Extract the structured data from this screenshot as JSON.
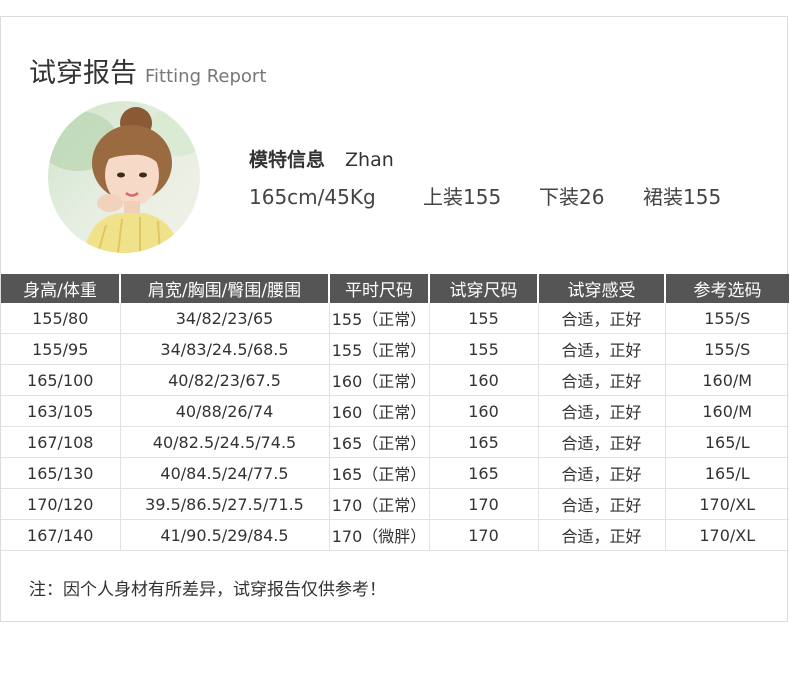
{
  "header": {
    "title_cn": "试穿报告",
    "title_en": "Fitting Report"
  },
  "model": {
    "label": "模特信息",
    "name": "Zhan",
    "height_weight": "165cm/45Kg",
    "top": "上装155",
    "bottom": "下装26",
    "skirt": "裙装155"
  },
  "table": {
    "headers": [
      "身高/体重",
      "肩宽/胸围/臀围/腰围",
      "平时尺码",
      "试穿尺码",
      "试穿感受",
      "参考选码"
    ],
    "rows": [
      [
        "155/80",
        "34/82/23/65",
        "155（正常）",
        "155",
        "合适，正好",
        "155/S"
      ],
      [
        "155/95",
        "34/83/24.5/68.5",
        "155（正常）",
        "155",
        "合适，正好",
        "155/S"
      ],
      [
        "165/100",
        "40/82/23/67.5",
        "160（正常）",
        "160",
        "合适，正好",
        "160/M"
      ],
      [
        "163/105",
        "40/88/26/74",
        "160（正常）",
        "160",
        "合适，正好",
        "160/M"
      ],
      [
        "167/108",
        "40/82.5/24.5/74.5",
        "165（正常）",
        "165",
        "合适，正好",
        "165/L"
      ],
      [
        "165/130",
        "40/84.5/24/77.5",
        "165（正常）",
        "165",
        "合适，正好",
        "165/L"
      ],
      [
        "170/120",
        "39.5/86.5/27.5/71.5",
        "170（正常）",
        "170",
        "合适，正好",
        "170/XL"
      ],
      [
        "167/140",
        "41/90.5/29/84.5",
        "170（微胖）",
        "170",
        "合适，正好",
        "170/XL"
      ]
    ]
  },
  "note": "注：因个人身材有所差异，试穿报告仅供参考！"
}
